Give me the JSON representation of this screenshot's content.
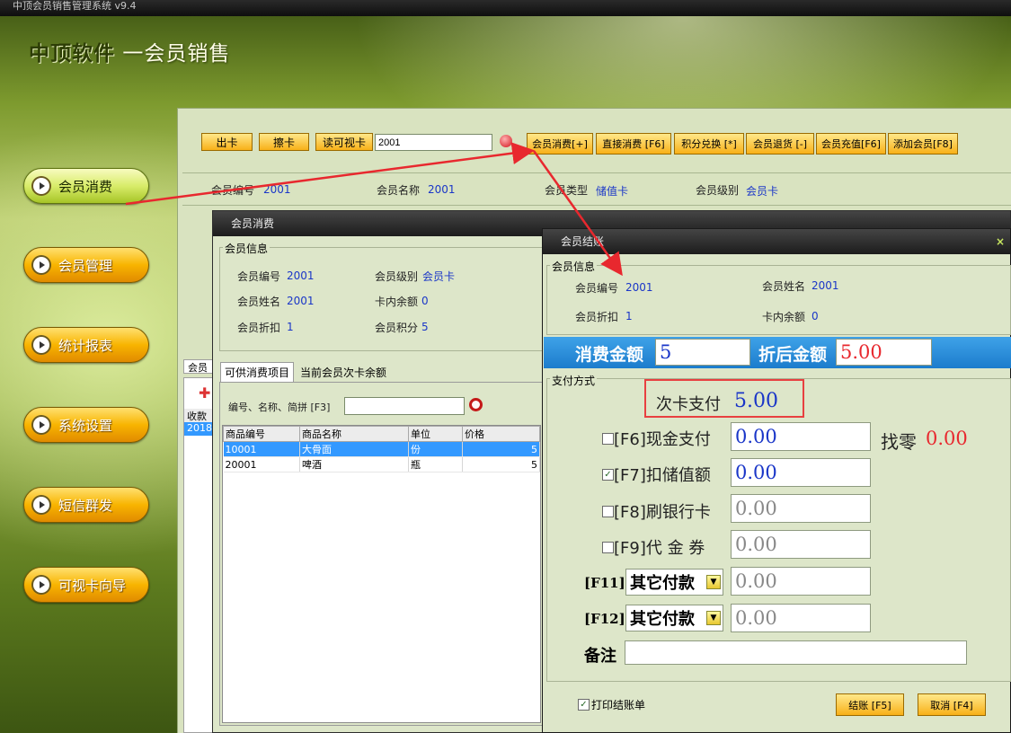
{
  "app": {
    "window_title": "中顶会员销售管理系统 v9.4",
    "brand_name": "中顶软件",
    "brand_sub": "一会员销售"
  },
  "nav": [
    {
      "label": "会员消费"
    },
    {
      "label": "会员管理"
    },
    {
      "label": "统计报表"
    },
    {
      "label": "系统设置"
    },
    {
      "label": "短信群发"
    },
    {
      "label": "可视卡向导"
    }
  ],
  "toolbar": {
    "out_card": "出卡",
    "wipe_card": "擦卡",
    "read_card": "读可视卡",
    "card_input": "2001",
    "actions": [
      "会员消费[+]",
      "直接消费 [F6]",
      "积分兑换 [*]",
      "会员退货 [-]",
      "会员充值[F6]",
      "添加会员[F8]"
    ]
  },
  "info_bar": {
    "id_label": "会员编号",
    "id_value": "2001",
    "name_label": "会员名称",
    "name_value": "2001",
    "type_label": "会员类型",
    "type_value": "储值卡",
    "level_label": "会员级别",
    "level_value": "会员卡"
  },
  "left_fragment": {
    "tab": "会员",
    "col": "收款",
    "row": "2018-"
  },
  "consume_window": {
    "title": "会员消费",
    "group": "会员信息",
    "id_label": "会员编号",
    "id_value": "2001",
    "level_label": "会员级别",
    "level_value": "会员卡",
    "name_label": "会员姓名",
    "name_value": "2001",
    "balance_label": "卡内余额",
    "balance_value": "0",
    "discount_label": "会员折扣",
    "discount_value": "1",
    "points_label": "会员积分",
    "points_value": "5",
    "tabs": [
      "可供消费项目",
      "当前会员次卡余额"
    ],
    "search_label": "编号、名称、简拼 [F3]",
    "table": {
      "columns": [
        "商品编号",
        "商品名称",
        "单位",
        "价格"
      ],
      "rows": [
        [
          "10001",
          "大骨面",
          "份",
          "5"
        ],
        [
          "20001",
          "啤酒",
          "瓶",
          "5"
        ]
      ]
    }
  },
  "checkout": {
    "title": "会员结账",
    "close": "×",
    "group_info": "会员信息",
    "id_label": "会员编号",
    "id_value": "2001",
    "name_label": "会员姓名",
    "name_value": "2001",
    "discount_label": "会员折扣",
    "discount_value": "1",
    "balance_label": "卡内余额",
    "balance_value": "0",
    "amount_label": "消费金额",
    "amount_value": "5",
    "after_label": "折后金额",
    "after_value": "5.00",
    "group_pay": "支付方式",
    "times_card_label": "次卡支付",
    "times_card_value": "5.00",
    "cash_label": "[F6]现金支付",
    "cash_value": "0.00",
    "cash_checked": false,
    "change_label": "找零",
    "change_value": "0.00",
    "stored_label": "[F7]扣储值额",
    "stored_value": "0.00",
    "stored_checked": true,
    "bank_label": "[F8]刷银行卡",
    "bank_value": "0.00",
    "bank_checked": false,
    "voucher_label": "[F9]代 金 券",
    "voucher_value": "0.00",
    "voucher_checked": false,
    "f11_label": "[F11]",
    "f11_select": "其它付款",
    "f11_value": "0.00",
    "f12_label": "[F12]",
    "f12_select": "其它付款",
    "f12_value": "0.00",
    "remark_label": "备注",
    "remark_value": "",
    "print_label": "打印结账单",
    "print_checked": true,
    "settle_button": "结账 [F5]",
    "cancel_button": "取消 [F4]"
  },
  "colors": {
    "accent_blue": "#1a36c8",
    "highlight_red": "#e8282e",
    "bar_blue": "#2e8fd8"
  }
}
